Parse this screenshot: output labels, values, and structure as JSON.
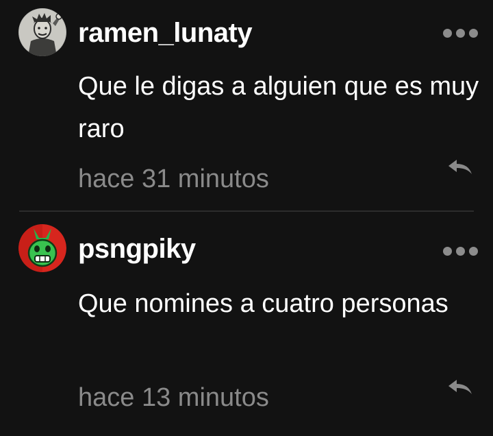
{
  "comments": [
    {
      "username": "ramen_lunaty",
      "text": "Que le digas a alguien que es muy raro",
      "timestamp": "hace 31 minutos",
      "avatar_icon": "character-avatar-gray",
      "more_icon": "ellipsis-icon",
      "reply_icon": "reply-arrow-icon"
    },
    {
      "username": "psngpiky",
      "text": "Que nomines a cuatro personas",
      "timestamp": "hace 13 minutos",
      "avatar_icon": "character-avatar-green-red",
      "more_icon": "ellipsis-icon",
      "reply_icon": "reply-arrow-icon"
    }
  ],
  "colors": {
    "background": "#121212",
    "text": "#ffffff",
    "muted": "#8a8a8a",
    "divider": "#2c2c2c"
  }
}
